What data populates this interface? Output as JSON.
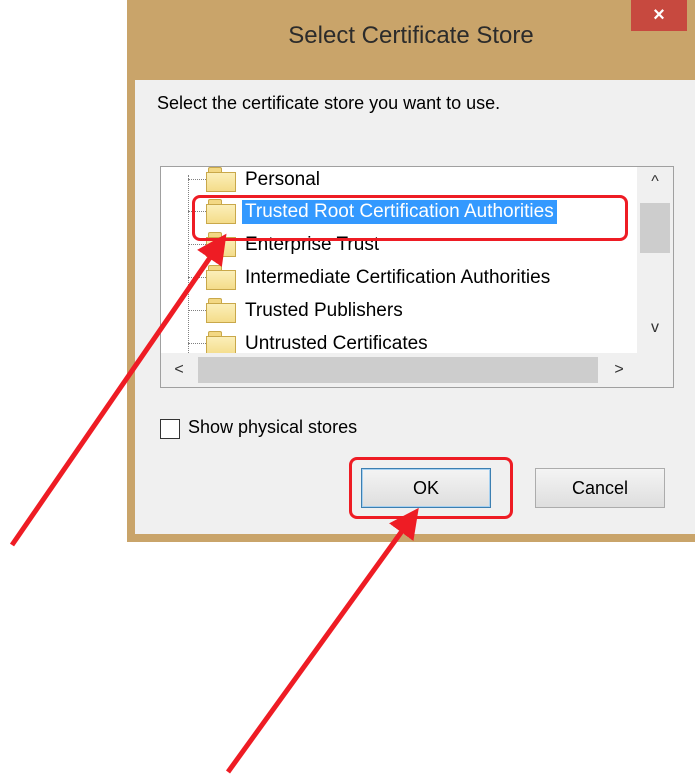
{
  "dialog": {
    "title": "Select Certificate Store",
    "close_label": "×",
    "prompt": "Select the certificate store you want to use."
  },
  "store_list": {
    "items": [
      {
        "label": "Personal",
        "selected": false
      },
      {
        "label": "Trusted Root Certification Authorities",
        "selected": true
      },
      {
        "label": "Enterprise Trust",
        "selected": false
      },
      {
        "label": "Intermediate Certification Authorities",
        "selected": false
      },
      {
        "label": "Trusted Publishers",
        "selected": false
      },
      {
        "label": "Untrusted Certificates",
        "selected": false
      }
    ],
    "scroll_up": "^",
    "scroll_down": "v",
    "scroll_left": "<",
    "scroll_right": ">"
  },
  "options": {
    "show_physical_stores_label": "Show physical stores",
    "show_physical_stores_checked": false
  },
  "buttons": {
    "ok_label": "OK",
    "cancel_label": "Cancel"
  },
  "annotations": {
    "highlight_color": "#ee1c24",
    "titlebar_color": "#c9a46a",
    "close_button_color": "#c7493f",
    "selection_color": "#3399ff"
  }
}
